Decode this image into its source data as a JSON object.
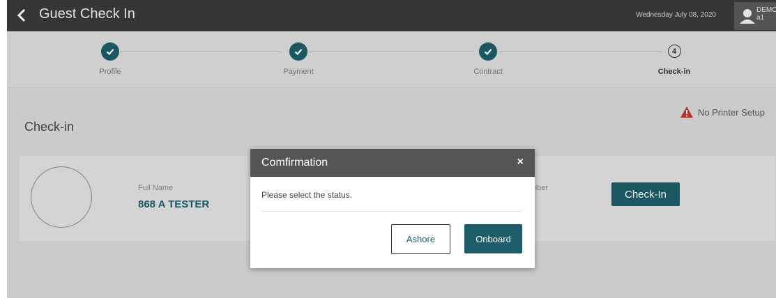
{
  "header": {
    "title": "Guest Check In",
    "date": "Wednesday July 08, 2020",
    "user_line1": "DEMO",
    "user_line2": "a1"
  },
  "stepper": {
    "steps": [
      {
        "label": "Profile",
        "state": "complete"
      },
      {
        "label": "Payment",
        "state": "complete"
      },
      {
        "label": "Contract",
        "state": "complete"
      },
      {
        "label": "Check-in",
        "state": "current",
        "number": "4"
      }
    ]
  },
  "content": {
    "title": "Check-in",
    "warning": "No Printer Setup",
    "card": {
      "full_name_label": "Full Name",
      "full_name": "868 A TESTER",
      "partial_label": "mber",
      "checkin_label": "Check-In"
    }
  },
  "dialog": {
    "title": "Comfirmation",
    "close": "×",
    "message": "Please select the status.",
    "ashore_label": "Ashore",
    "onboard_label": "Onboard"
  },
  "colors": {
    "header_bg": "#3a3a3a",
    "accent_teal": "#1d5d6a",
    "warning_red": "#c0392b",
    "dialog_header": "#555555"
  }
}
